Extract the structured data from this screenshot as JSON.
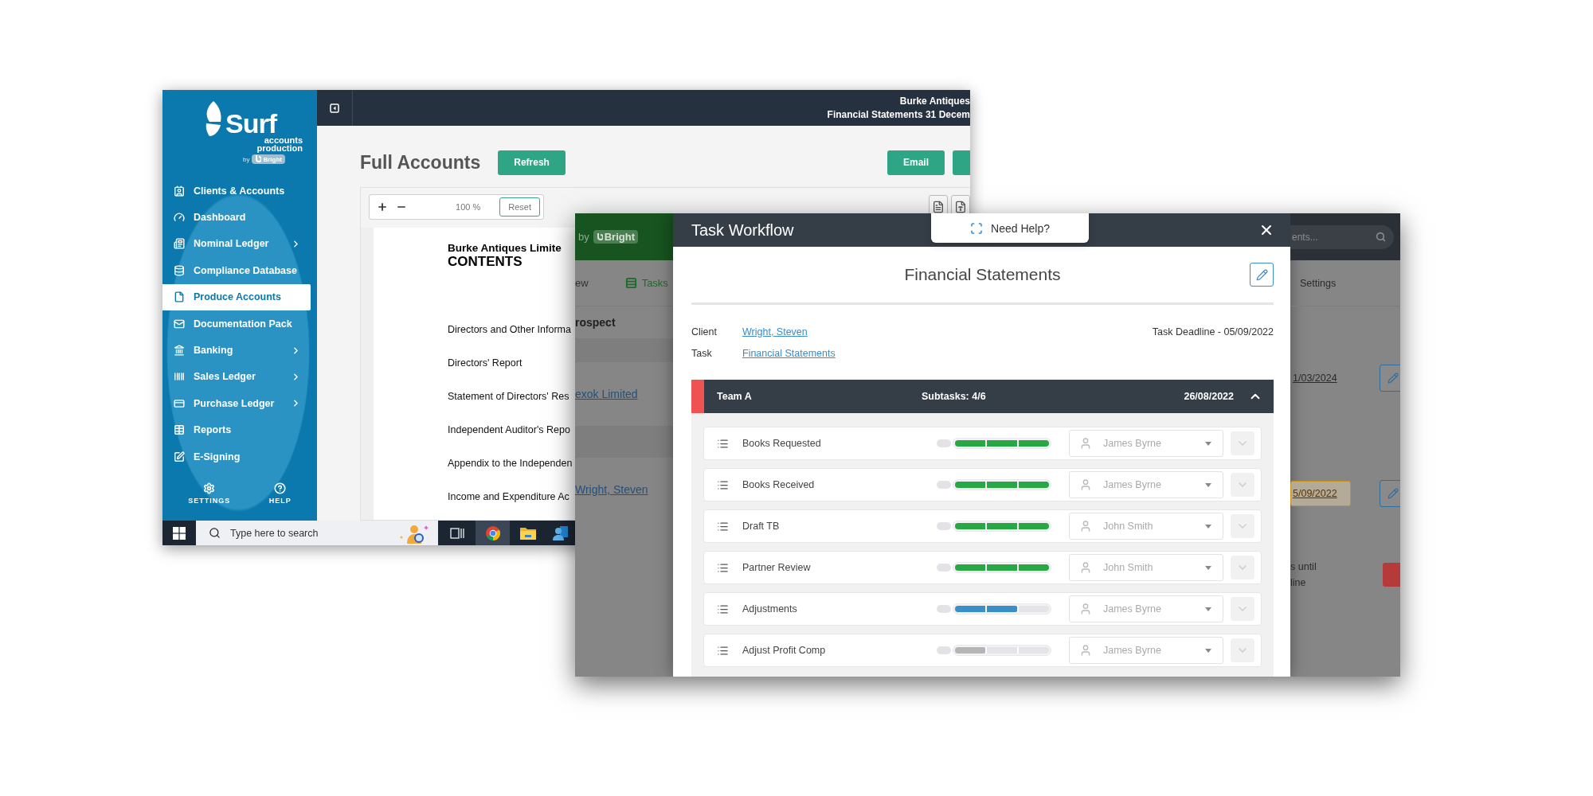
{
  "back_window": {
    "logo": {
      "name": "Surf",
      "line_1": "accounts",
      "line_2": "production",
      "by": "by",
      "brand": "Bright"
    },
    "sidebar": [
      {
        "label": "Clients & Accounts",
        "selected": false,
        "submenu": false
      },
      {
        "label": "Dashboard",
        "selected": false,
        "submenu": false
      },
      {
        "label": "Nominal Ledger",
        "selected": false,
        "submenu": true
      },
      {
        "label": "Compliance Database",
        "selected": false,
        "submenu": false
      },
      {
        "label": "Produce Accounts",
        "selected": true,
        "submenu": false
      },
      {
        "label": "Documentation Pack",
        "selected": false,
        "submenu": false
      },
      {
        "label": "Banking",
        "selected": false,
        "submenu": true
      },
      {
        "label": "Sales Ledger",
        "selected": false,
        "submenu": true
      },
      {
        "label": "Purchase Ledger",
        "selected": false,
        "submenu": true
      },
      {
        "label": "Reports",
        "selected": false,
        "submenu": false
      },
      {
        "label": "E-Signing",
        "selected": false,
        "submenu": false
      }
    ],
    "sidebar_footer": [
      {
        "label": "SETTINGS"
      },
      {
        "label": "HELP"
      }
    ],
    "header": {
      "line_1": "Burke Antiques",
      "line_2": "Financial Statements 31 Decem"
    },
    "title": "Full Accounts",
    "refresh_button": "Refresh",
    "email_button": "Email",
    "viewer": {
      "zoom": "100 %",
      "reset": "Reset"
    },
    "document": {
      "company": "Burke Antiques Limite",
      "heading": "CONTENTS",
      "entries": [
        "Directors and Other Informa",
        "Directors' Report",
        "Statement of Directors' Res",
        "Independent Auditor's Repo",
        "Appendix to the Independen",
        "Income and Expenditure Ac"
      ]
    },
    "taskbar": {
      "search_placeholder": "Type here to search"
    }
  },
  "front_window": {
    "backdrop_left": {
      "by": "by",
      "brand": "Bright",
      "tab": "ew",
      "tasks": "Tasks",
      "section": "rospect",
      "links": [
        "exok Limited",
        "Wright, Steven"
      ]
    },
    "backdrop_right": {
      "search_placeholder": "ents...",
      "settings": "Settings",
      "deadlines": [
        {
          "date": "1/03/2024",
          "overdue": false
        },
        {
          "date": "5/09/2022",
          "overdue": true
        }
      ],
      "countdown": [
        "s until",
        "line"
      ]
    },
    "help_tab": "Need Help?",
    "modal": {
      "title": "Task Workflow",
      "heading": "Financial Statements",
      "client_label": "Client",
      "client": "Wright, Steven",
      "task_label": "Task",
      "task": "Financial Statements",
      "deadline": "Task Deadline - 05/09/2022",
      "team": {
        "name": "Team A",
        "subtasks": "Subtasks: 4/6",
        "date": "26/08/2022",
        "expanded": true,
        "color": "#f05252"
      },
      "subtasks": [
        {
          "name": "Books Requested",
          "level": 1,
          "color": "#28a745",
          "assignee": "James Byrne"
        },
        {
          "name": "Books Received",
          "level": 1,
          "color": "#28a745",
          "assignee": "James Byrne"
        },
        {
          "name": "Draft TB",
          "level": 1,
          "color": "#28a745",
          "assignee": "John Smith"
        },
        {
          "name": "Partner Review",
          "level": 1,
          "color": "#28a745",
          "assignee": "John Smith"
        },
        {
          "name": "Adjustments",
          "level": 0.67,
          "color": "#3a8fc6",
          "assignee": "James Byrne"
        },
        {
          "name": "Adjust Profit Comp",
          "level": 0.33,
          "color": "#b5b5b5",
          "assignee": "James Byrne"
        }
      ]
    }
  }
}
